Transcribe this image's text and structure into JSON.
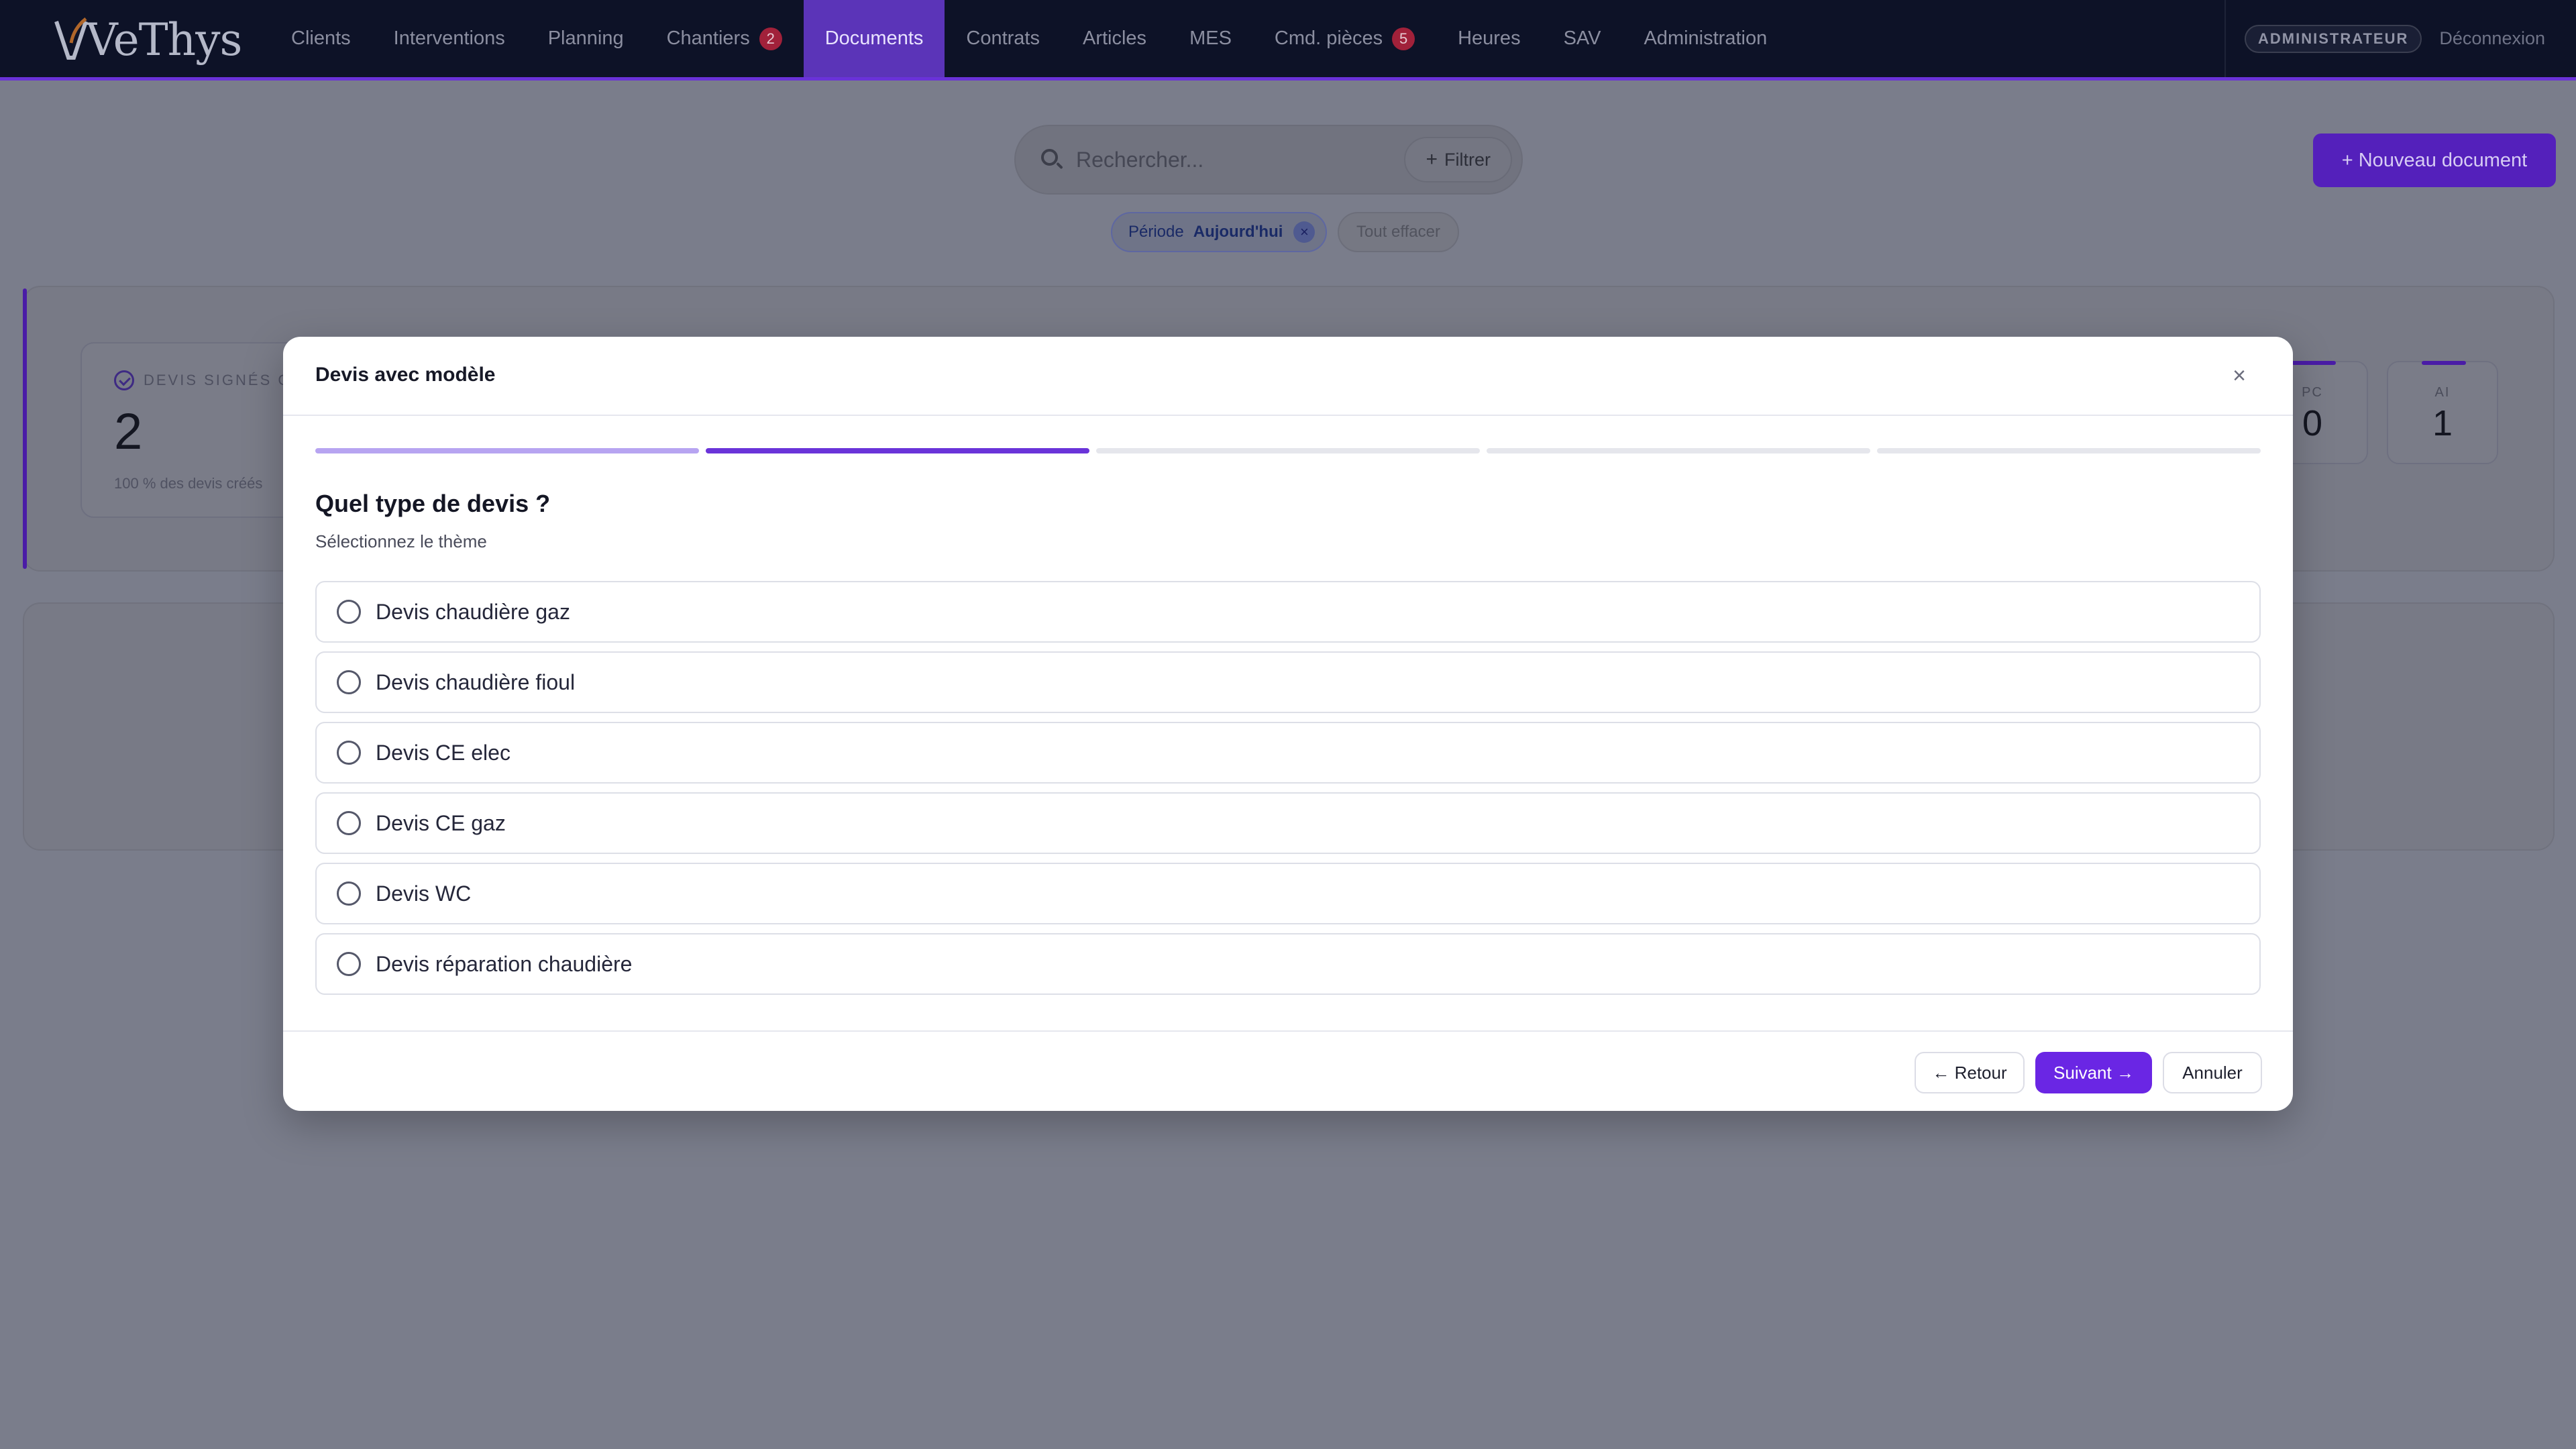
{
  "brand": {
    "logo_text": "VeThys"
  },
  "nav": {
    "items": [
      {
        "label": "Clients"
      },
      {
        "label": "Interventions"
      },
      {
        "label": "Planning"
      },
      {
        "label": "Chantiers",
        "badge": "2"
      },
      {
        "label": "Documents",
        "active": true
      },
      {
        "label": "Contrats"
      },
      {
        "label": "Articles"
      },
      {
        "label": "MES"
      },
      {
        "label": "Cmd. pièces",
        "badge": "5"
      },
      {
        "label": "Heures"
      },
      {
        "label": "SAV"
      },
      {
        "label": "Administration"
      }
    ],
    "role": "ADMINISTRATEUR",
    "logout": "Déconnexion"
  },
  "toolbar": {
    "search_placeholder": "Rechercher...",
    "filter_label": "Filtrer",
    "new_document_label": "+ Nouveau document"
  },
  "filters": {
    "period_label": "Période",
    "period_value": "Aujourd'hui",
    "clear_label": "Tout effacer"
  },
  "stats": {
    "signed": {
      "label": "DEVIS SIGNÉS CE",
      "value": "2",
      "sub": "100 % des devis créés"
    },
    "mini": [
      {
        "label": "PC",
        "value": "0"
      },
      {
        "label": "AI",
        "value": "1"
      }
    ]
  },
  "modal": {
    "title": "Devis avec modèle",
    "close_icon": "close-icon",
    "steps_total": 5,
    "current_step": 2,
    "question": "Quel type de devis ?",
    "hint": "Sélectionnez le thème",
    "options": [
      {
        "label": "Devis chaudière gaz"
      },
      {
        "label": "Devis chaudière fioul"
      },
      {
        "label": "Devis CE elec"
      },
      {
        "label": "Devis CE gaz"
      },
      {
        "label": "Devis WC"
      },
      {
        "label": "Devis réparation chaudière"
      }
    ],
    "buttons": {
      "back": "← Retour",
      "next": "Suivant →",
      "cancel": "Annuler"
    }
  },
  "colors": {
    "accent": "#6a26e4",
    "nav_bg": "#0d1227",
    "overlay": "#7a7d8b"
  }
}
